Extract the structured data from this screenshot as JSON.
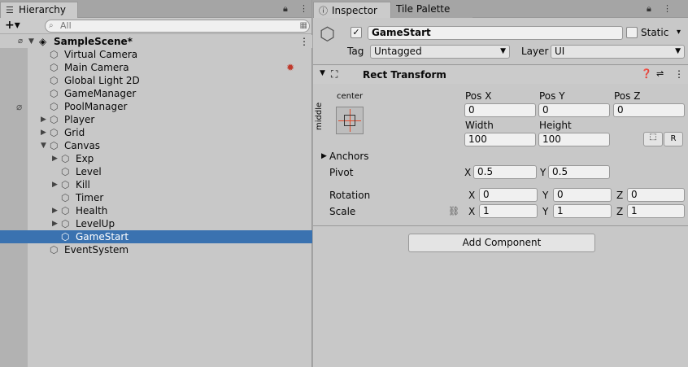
{
  "hierarchy": {
    "tab_label": "Hierarchy",
    "search_placeholder": "All",
    "scene_name": "SampleScene*",
    "items": [
      {
        "label": "Virtual Camera"
      },
      {
        "label": "Main Camera"
      },
      {
        "label": "Global Light 2D"
      },
      {
        "label": "GameManager"
      },
      {
        "label": "PoolManager"
      },
      {
        "label": "Player"
      },
      {
        "label": "Grid"
      },
      {
        "label": "Canvas"
      },
      {
        "label": "Exp"
      },
      {
        "label": "Level"
      },
      {
        "label": "Kill"
      },
      {
        "label": "Timer"
      },
      {
        "label": "Health"
      },
      {
        "label": "LevelUp"
      },
      {
        "label": "GameStart"
      },
      {
        "label": "EventSystem"
      }
    ]
  },
  "inspector": {
    "tab_label": "Inspector",
    "tab2_label": "Tile Palette",
    "object_name": "GameStart",
    "static_label": "Static",
    "tag_label": "Tag",
    "tag_value": "Untagged",
    "layer_label": "Layer",
    "layer_value": "UI",
    "component_title": "Rect Transform",
    "anchor_h": "center",
    "anchor_v": "middle",
    "posx_label": "Pos X",
    "posx": "0",
    "posy_label": "Pos Y",
    "posy": "0",
    "posz_label": "Pos Z",
    "posz": "0",
    "width_label": "Width",
    "width": "100",
    "height_label": "Height",
    "height": "100",
    "r_button": "R",
    "anchors_label": "Anchors",
    "pivot_label": "Pivot",
    "pivot_x": "0.5",
    "pivot_y": "0.5",
    "rotation_label": "Rotation",
    "rot_x": "0",
    "rot_y": "0",
    "rot_z": "0",
    "scale_label": "Scale",
    "scale_x": "1",
    "scale_y": "1",
    "scale_z": "1",
    "x": "X",
    "y": "Y",
    "z": "Z",
    "add_component": "Add Component"
  },
  "colors": {
    "selection": "#3a72b0"
  }
}
